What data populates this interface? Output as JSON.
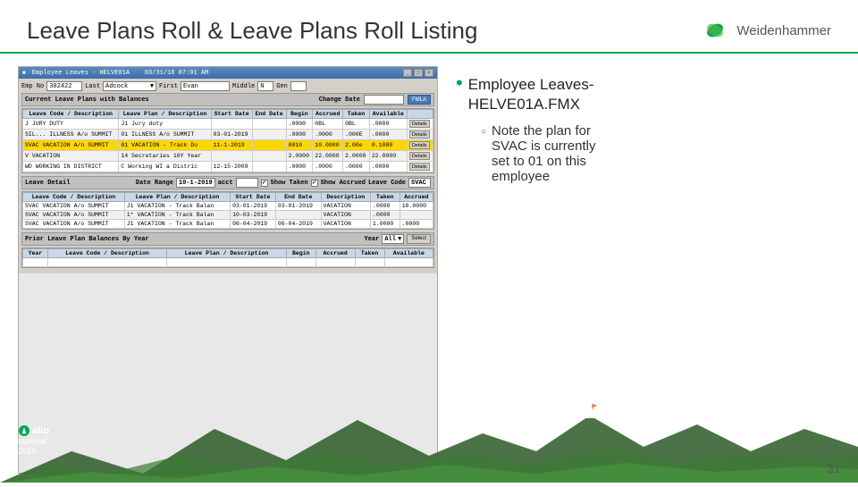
{
  "header": {
    "title": "Leave Plans Roll & Leave Plans Roll Listing",
    "logo_text": "Weidenhammer"
  },
  "mockup": {
    "titlebar": {
      "title": "Employee Leaves - HELVE01A",
      "date": "03/31/18  07:01 AM"
    },
    "fields": {
      "emp_no_label": "Emp No",
      "emp_no_value": "302422",
      "last_label": "Last",
      "last_value": "Adcock",
      "first_label": "First",
      "first_value": "Evan",
      "middle_label": "Middle",
      "middle_value": "N",
      "gen_label": "Gen"
    },
    "section1": {
      "title": "Current Leave Plans with Balances",
      "change_date_label": "Change Date",
      "fmla_btn": "FMLA",
      "columns": [
        "Leave Code / Description",
        "Leave Plan / Description",
        "Start Date",
        "End Date",
        "Begin",
        "Accrued",
        "Taken",
        "Available",
        ""
      ],
      "rows": [
        {
          "code": "J",
          "desc": "JURY DUTY",
          "plan": "J1",
          "plan_desc": "Jury duty",
          "start": "",
          "end": "",
          "begin": ".0000",
          "accrued": "0BL",
          "taken": "0BL",
          "avail": ".0000",
          "highlight": ""
        },
        {
          "code": "SIL...",
          "desc": "ILLNESS A/o SUMMIT",
          "plan": "01",
          "plan_desc": "ILLNESS A/o SUMMIT",
          "start": "03-01-2019",
          "end": "",
          "begin": ".0000",
          "accrued": ".0000",
          "taken": ".000E",
          "avail": ".0000",
          "highlight": ""
        },
        {
          "code": "SVAC",
          "desc": "VACATION A/o SUMMIT",
          "plan": "01",
          "plan_desc": "VACATION - Track Do",
          "start": "11-1-2019",
          "end": "",
          "begin": "0010",
          "accrued": "10.0000",
          "taken": "2.00e",
          "avail": "0.1000",
          "highlight": "orange"
        },
        {
          "code": "V",
          "desc": "VACATION",
          "plan": "14",
          "plan_desc": "Secretaries 10Y Year",
          "start": "",
          "end": "",
          "begin": "2.0000",
          "accrued": "22.0000",
          "taken": "2.0000",
          "avail": "22.0000",
          "highlight": ""
        },
        {
          "code": "WD",
          "desc": "WORKING IN DISTRICT",
          "plan": "C",
          "plan_desc": "Working WI a Distric",
          "start": "12-15-2009",
          "end": "",
          "begin": ".0000",
          "accrued": ".0000",
          "taken": ".0000",
          "avail": ".0000",
          "highlight": ""
        }
      ]
    },
    "section2": {
      "title": "Leave Detail",
      "date_range_label": "Date Range",
      "date_range_value": "10-1-2019",
      "acct_label": "acct",
      "show_taken_label": "Show Taken",
      "show_accrued_label": "Show Accrued",
      "leave_code_label": "Leave Code",
      "leave_code_value": "SVAC",
      "columns": [
        "Leave Code / Description",
        "Leave Plan / Description",
        "Start Date",
        "End Date",
        "Description",
        "Taken",
        "Accrued"
      ],
      "rows": [
        {
          "code": "SVAC",
          "desc": "VACATION A/o SUMMIT",
          "plan": "J1",
          "plan_desc": "VACATION - Track Balan",
          "start": "03-01-2019",
          "end": "03-01-2019",
          "description": "VACATION",
          "taken": ".0000",
          "accrued": "10.0000"
        },
        {
          "code": "SVAC",
          "desc": "VACATION A/o SUMMIT",
          "plan": "1*",
          "plan_desc": "VACATION - Track Balan",
          "start": "10-03-2019",
          "end": "",
          "description": "VACATION",
          "taken": ".0000",
          "accrued": ""
        },
        {
          "code": "SVAC",
          "desc": "VACATION A/o SUMMIT",
          "plan": "J1",
          "plan_desc": "VACATION - Track Balan",
          "start": "06-04-2019",
          "end": "06-04-2019",
          "description": "VACATION",
          "taken": "1.0000",
          "accrued": ".0000"
        }
      ]
    },
    "section3": {
      "title": "Prior Leave Plan Balances By Year",
      "year_label": "Year",
      "year_value": "All",
      "select_btn": "Select",
      "columns": [
        "Year",
        "Leave Code / Description",
        "Leave Plan / Description",
        "Begin",
        "Accrued",
        "Taken",
        "Available"
      ]
    }
  },
  "bullets": {
    "main": "Employee Leaves-\nHELVE01A.FMX",
    "subs": [
      "Note the plan for\nSVAC is currently\nset to 01 on this\nemployee"
    ]
  },
  "footer": {
    "logo_text": "alio summit",
    "year": "2019",
    "page_number": "31"
  }
}
